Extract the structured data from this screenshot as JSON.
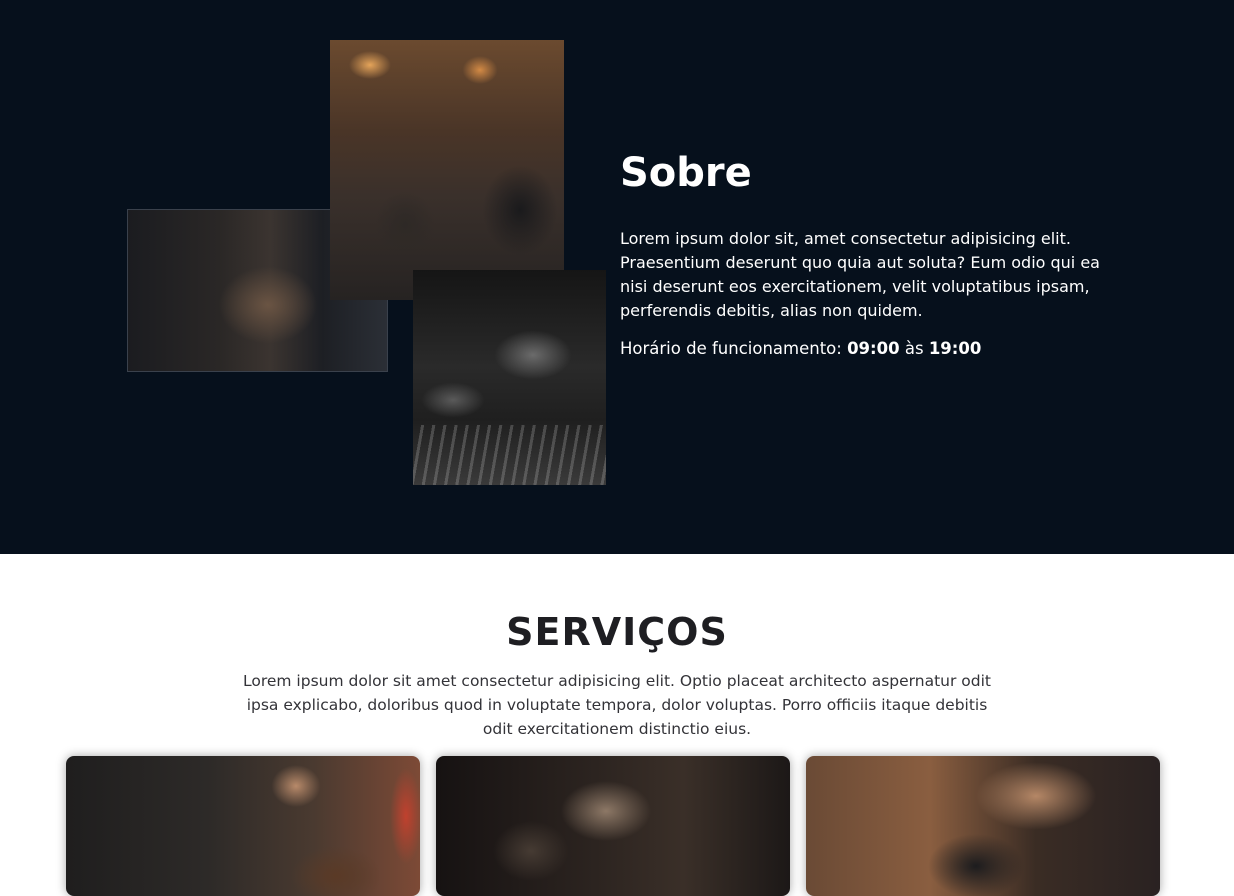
{
  "about": {
    "title": "Sobre",
    "text": "Lorem ipsum dolor sit, amet consectetur adipisicing elit. Praesentium deserunt quo quia aut soluta? Eum odio qui ea nisi deserunt eos exercitationem, velit voluptatibus ipsam, perferendis debitis, alias non quidem.",
    "hours_label": "Horário de funcionamento:",
    "hours_open": "09:00",
    "hours_connector": "às",
    "hours_close": "19:00",
    "background_color": "#06101c"
  },
  "services": {
    "title": "SERVIÇOS",
    "text": "Lorem ipsum dolor sit amet consectetur adipisicing elit. Optio placeat architecto aspernatur odit ipsa explicabo, doloribus quod in voluptate tempora, dolor voluptas. Porro officiis itaque debitis odit exercitationem distinctio eius."
  }
}
